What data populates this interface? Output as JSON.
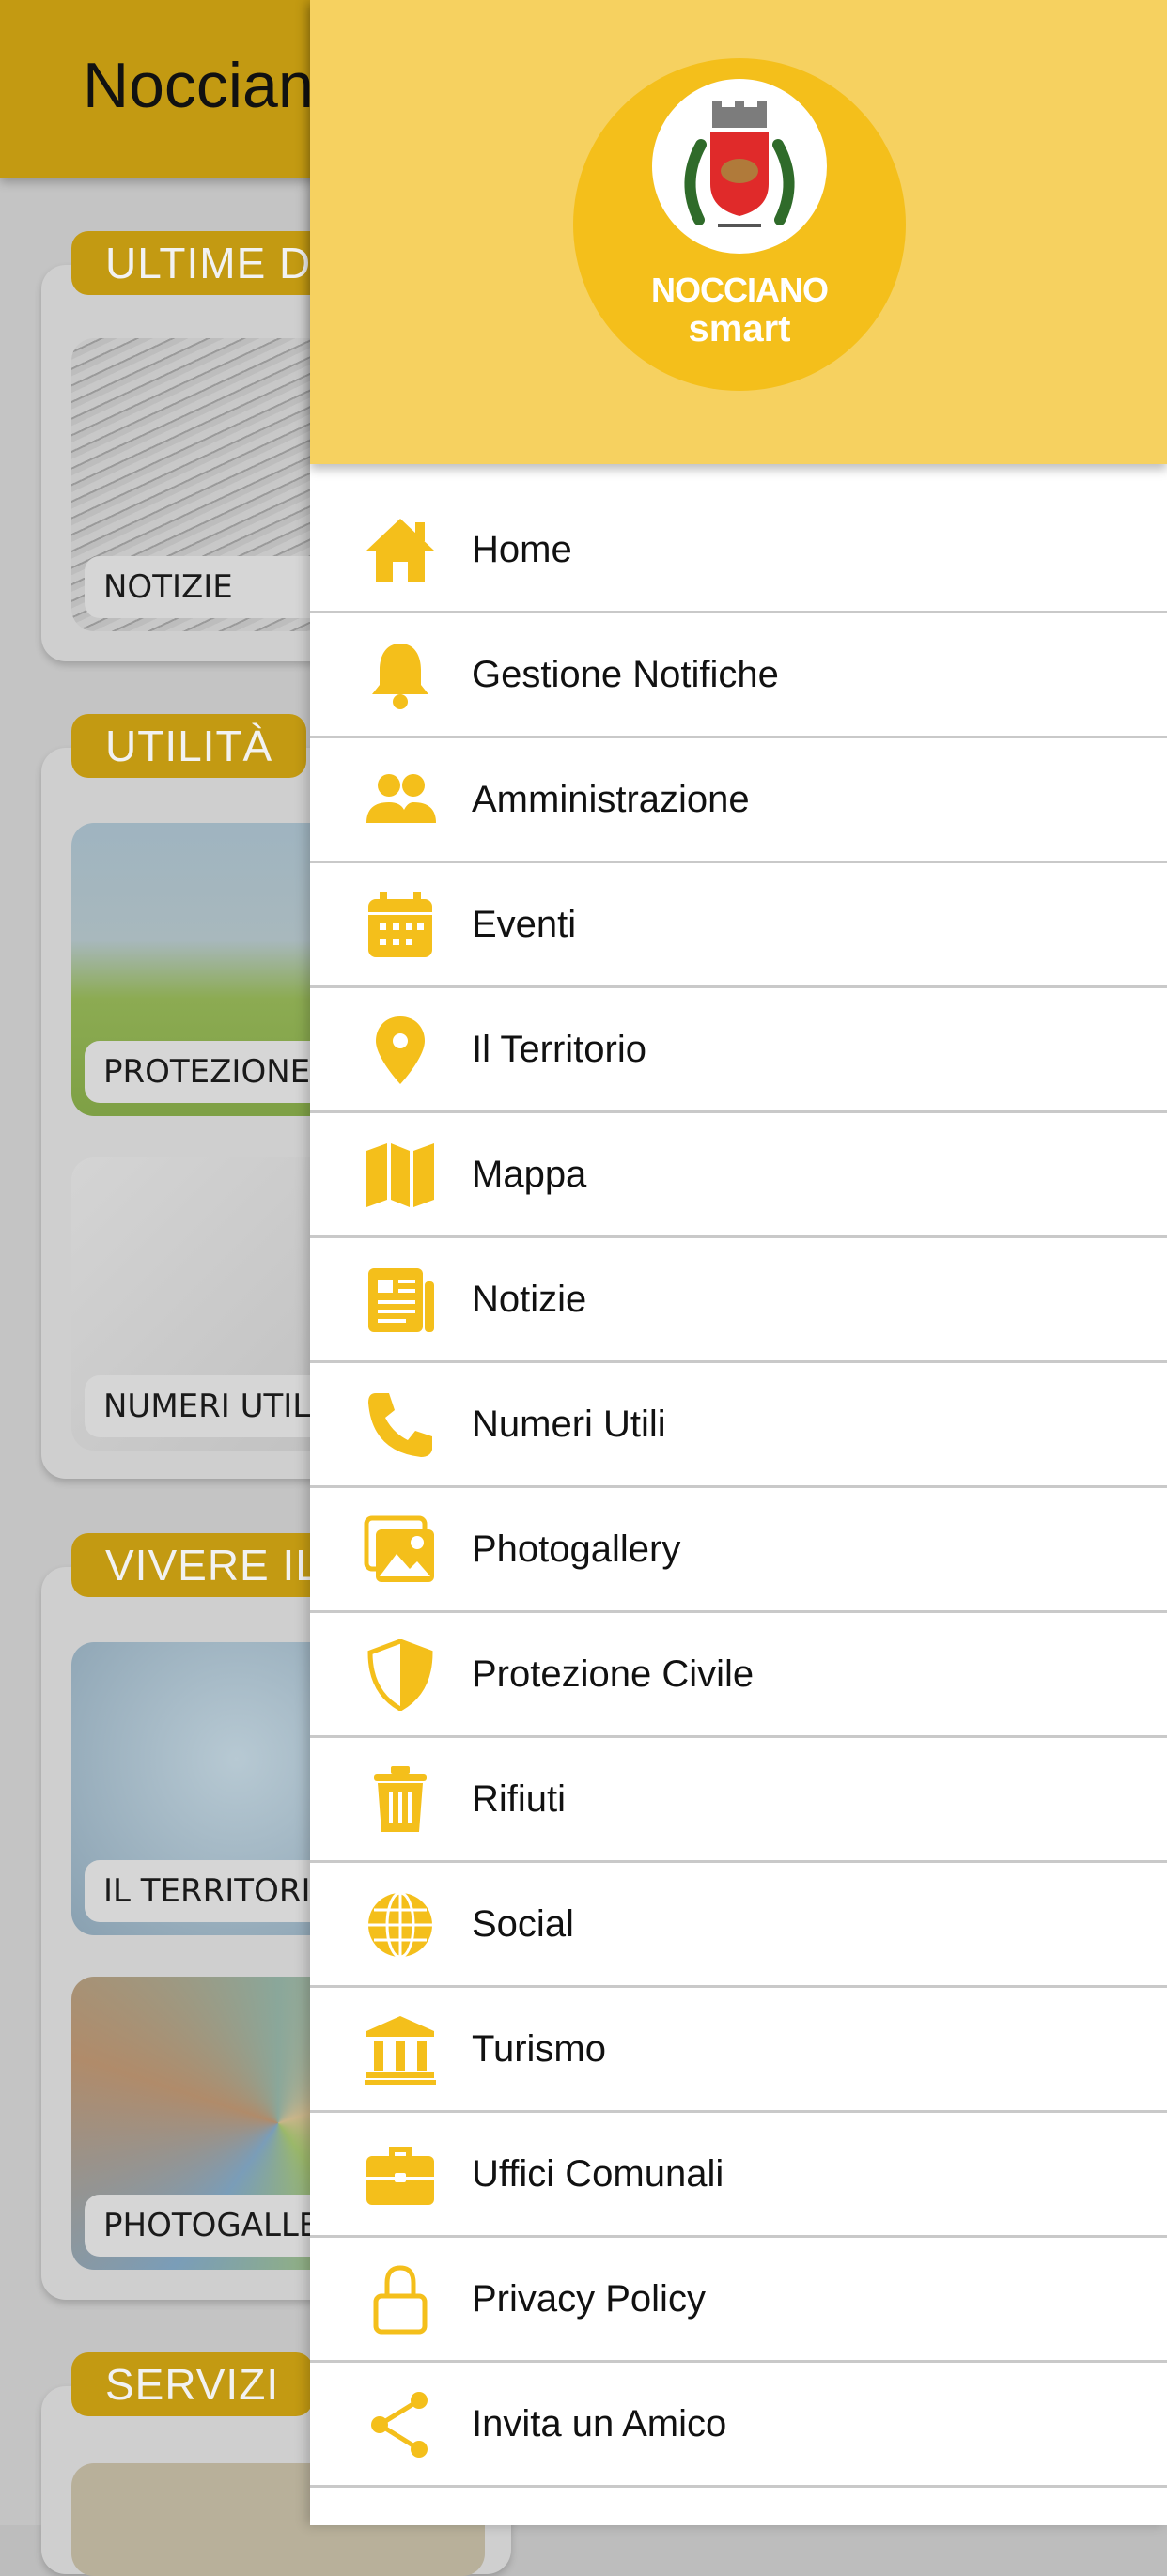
{
  "colors": {
    "accent": "#f4bf1b",
    "header_bg": "#f6d160",
    "appbar_bg": "#c39a12"
  },
  "app": {
    "title": "Nocciano",
    "sections": [
      {
        "label": "ULTIME DALL'ENTE",
        "tiles": [
          {
            "label": "NOTIZIE"
          }
        ]
      },
      {
        "label": "UTILITÀ",
        "tiles": [
          {
            "label": "PROTEZIONE CIVILE"
          },
          {
            "label": "NUMERI UTILI"
          }
        ]
      },
      {
        "label": "VIVERE IL TERRITORIO",
        "tiles": [
          {
            "label": "IL TERRITORIO"
          },
          {
            "label": "PHOTOGALLERY"
          }
        ]
      },
      {
        "label": "SERVIZI",
        "tiles": []
      }
    ]
  },
  "drawer": {
    "logo": {
      "line1": "NOCCIANO",
      "line2": "smart"
    },
    "items": [
      {
        "label": "Home",
        "icon": "home-icon"
      },
      {
        "label": "Gestione Notifiche",
        "icon": "bell-icon"
      },
      {
        "label": "Amministrazione",
        "icon": "users-icon"
      },
      {
        "label": "Eventi",
        "icon": "calendar-icon"
      },
      {
        "label": "Il Territorio",
        "icon": "map-pin-icon"
      },
      {
        "label": "Mappa",
        "icon": "map-icon"
      },
      {
        "label": "Notizie",
        "icon": "newspaper-icon"
      },
      {
        "label": "Numeri Utili",
        "icon": "phone-icon"
      },
      {
        "label": "Photogallery",
        "icon": "images-icon"
      },
      {
        "label": "Protezione Civile",
        "icon": "shield-icon"
      },
      {
        "label": "Rifiuti",
        "icon": "trash-icon"
      },
      {
        "label": "Social",
        "icon": "globe-icon"
      },
      {
        "label": "Turismo",
        "icon": "landmark-icon"
      },
      {
        "label": "Uffici Comunali",
        "icon": "briefcase-icon"
      },
      {
        "label": "Privacy Policy",
        "icon": "lock-icon"
      },
      {
        "label": "Invita un Amico",
        "icon": "share-icon"
      }
    ]
  }
}
